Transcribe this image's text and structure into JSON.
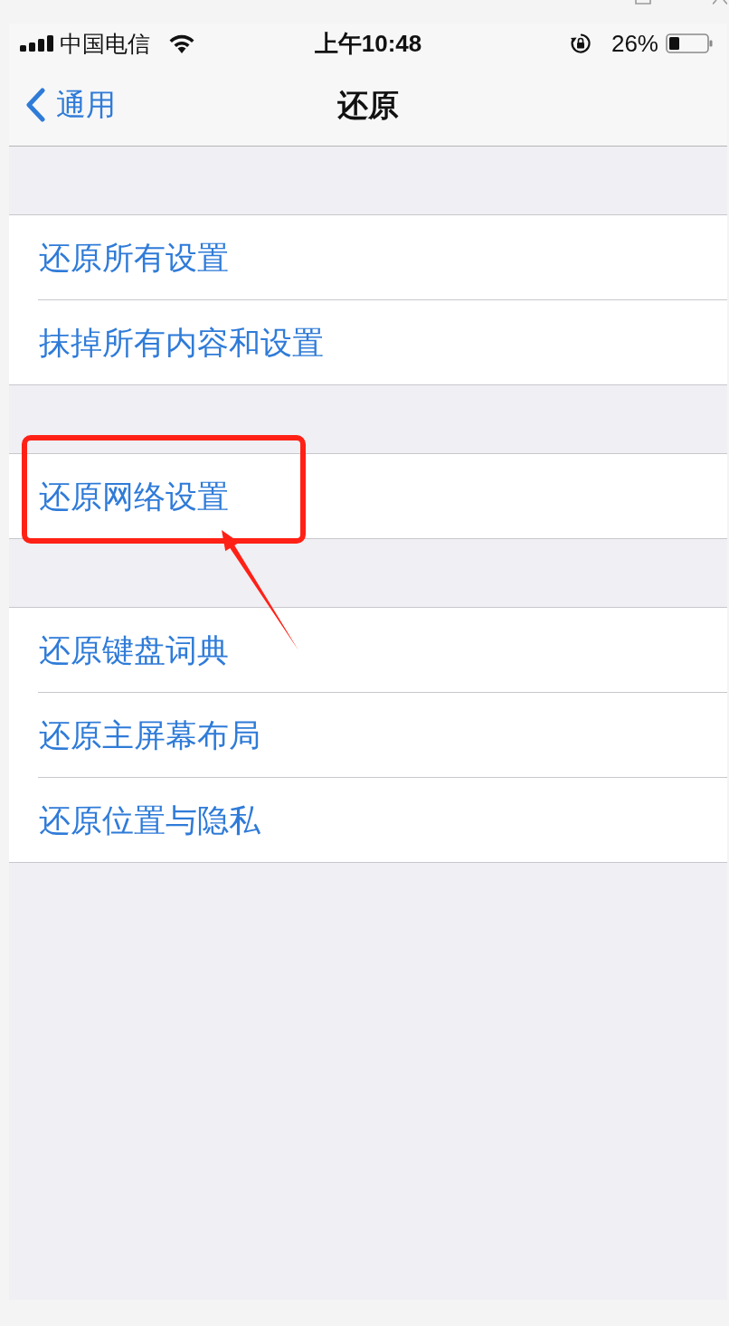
{
  "status_bar": {
    "carrier": "中国电信",
    "time": "上午10:48",
    "battery": "26%"
  },
  "nav_bar": {
    "back": "通用",
    "title": "还原"
  },
  "groups": [
    {
      "items": [
        {
          "label": "还原所有设置",
          "highlighted": false
        },
        {
          "label": "抹掉所有内容和设置",
          "highlighted": false
        }
      ]
    },
    {
      "items": [
        {
          "label": "还原网络设置",
          "highlighted": true
        }
      ]
    },
    {
      "items": [
        {
          "label": "还原键盘词典",
          "highlighted": false
        },
        {
          "label": "还原主屏幕布局",
          "highlighted": false
        },
        {
          "label": "还原位置与隐私",
          "highlighted": false
        }
      ]
    }
  ]
}
